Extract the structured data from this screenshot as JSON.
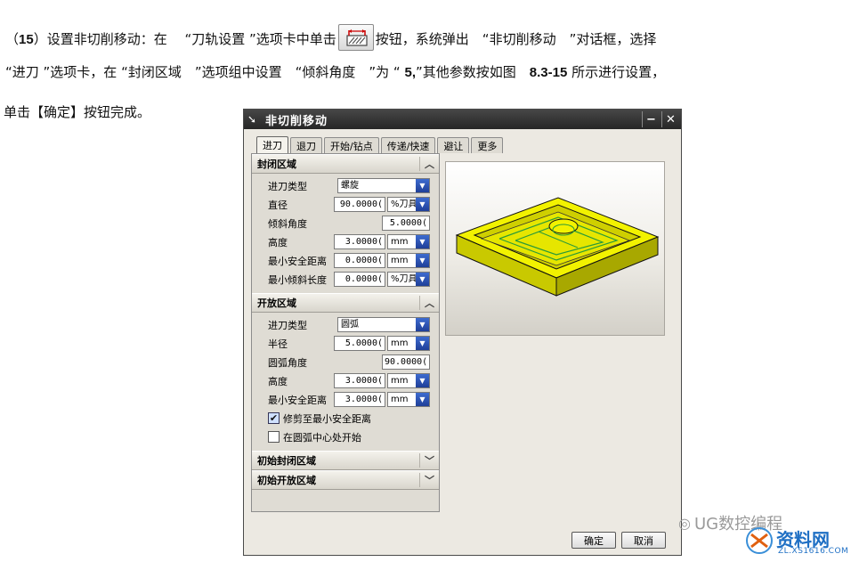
{
  "paragraph": {
    "line1_start": "（",
    "step_number": "15",
    "line1_mid": "）设置非切削移动：在　 “刀轨设置 ”选项卡中单击",
    "line1_end": "按钮，系统弹出　“非切削移动　”对话框，选择",
    "line2_a": "“进刀 ”选项卡，在 “封闭区域　”选项组中设置　“倾斜角度　”为 “ ",
    "value_5": "5,",
    "line2_b": "”其他参数按如图　",
    "figure_ref": "8.3-15",
    "line2_c": " 所示进行设置，",
    "line3": "单击【确定】按钮完成。",
    "tool_icon": "non-cutting-moves-icon"
  },
  "dialog": {
    "title": "非切削移动",
    "tabs": [
      "进刀",
      "退刀",
      "开始/钻点",
      "传递/快速",
      "避让",
      "更多"
    ],
    "closed_region": {
      "header": "封闭区域",
      "rows": {
        "type_label": "进刀类型",
        "type_value": "螺旋",
        "diameter_label": "直径",
        "diameter_value": "90.0000(",
        "diameter_unit": "%刀具",
        "ramp_label": "倾斜角度",
        "ramp_value": "5.0000(",
        "height_label": "高度",
        "height_value": "3.0000(",
        "height_unit": "mm",
        "min_safe_label": "最小安全距离",
        "min_safe_value": "0.0000(",
        "min_safe_unit": "mm",
        "min_ramp_label": "最小倾斜长度",
        "min_ramp_value": "0.0000(",
        "min_ramp_unit": "%刀具"
      }
    },
    "open_region": {
      "header": "开放区域",
      "rows": {
        "type_label": "进刀类型",
        "type_value": "圆弧",
        "radius_label": "半径",
        "radius_value": "5.0000(",
        "radius_unit": "mm",
        "arc_angle_label": "圆弧角度",
        "arc_angle_value": "90.0000(",
        "height_label": "高度",
        "height_value": "3.0000(",
        "height_unit": "mm",
        "min_safe_label": "最小安全距离",
        "min_safe_value": "3.0000(",
        "min_safe_unit": "mm"
      },
      "trim_checkbox": "修剪至最小安全距离",
      "trim_checked": true,
      "center_checkbox": "在圆弧中心处开始",
      "center_checked": false
    },
    "initial_closed": "初始封闭区域",
    "initial_open": "初始开放区域",
    "ok": "确定",
    "cancel": "取消",
    "model_color": "#f0f000"
  },
  "watermark": {
    "channel": "UG数控编程",
    "site": "资料网",
    "url": "ZL.XS1616.COM"
  }
}
